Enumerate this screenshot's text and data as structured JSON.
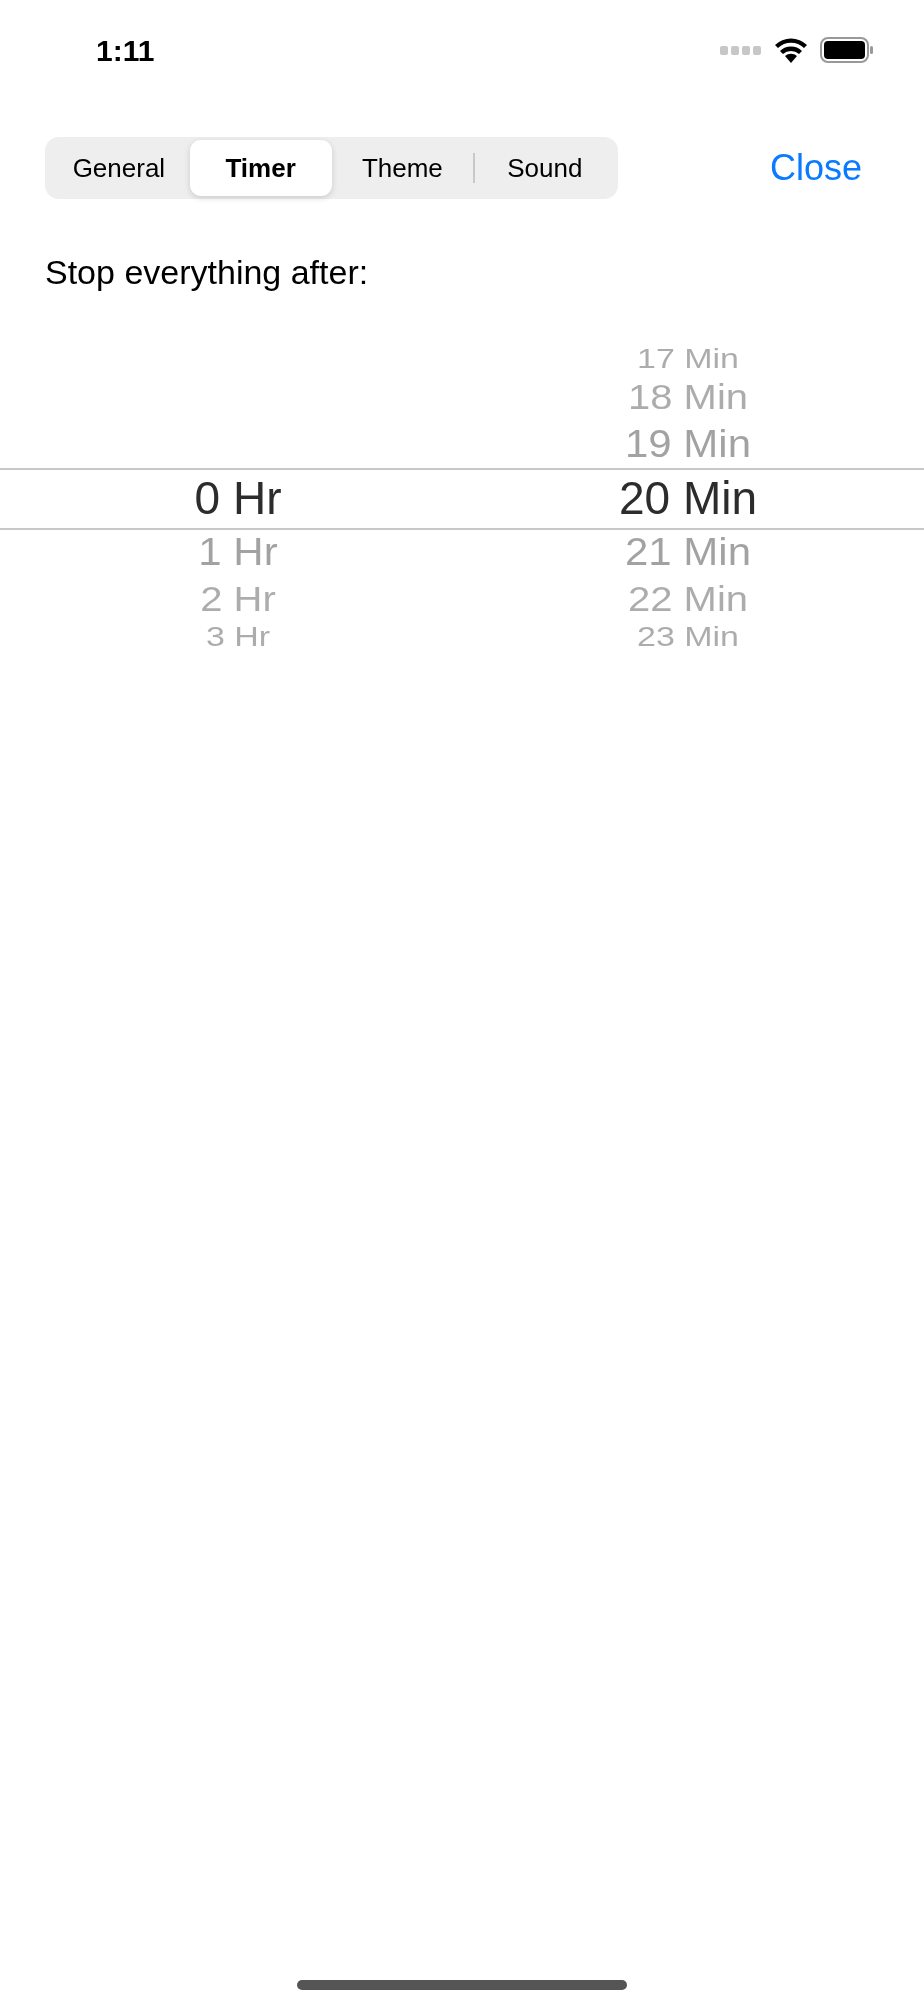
{
  "status_bar": {
    "time": "1:11"
  },
  "tabs": [
    {
      "label": "General",
      "selected": false
    },
    {
      "label": "Timer",
      "selected": true
    },
    {
      "label": "Theme",
      "selected": false
    },
    {
      "label": "Sound",
      "selected": false
    }
  ],
  "close_button": "Close",
  "prompt": "Stop everything after:",
  "picker": {
    "columns": [
      {
        "items": [
          {
            "label": "0 Hr",
            "selected": true
          },
          {
            "label": "1 Hr",
            "selected": false
          },
          {
            "label": "2 Hr",
            "selected": false
          },
          {
            "label": "3 Hr",
            "selected": false
          }
        ]
      },
      {
        "items": [
          {
            "label": "17 Min",
            "selected": false
          },
          {
            "label": "18 Min",
            "selected": false
          },
          {
            "label": "19 Min",
            "selected": false
          },
          {
            "label": "20 Min",
            "selected": true
          },
          {
            "label": "21 Min",
            "selected": false
          },
          {
            "label": "22 Min",
            "selected": false
          },
          {
            "label": "23 Min",
            "selected": false
          }
        ]
      }
    ]
  }
}
